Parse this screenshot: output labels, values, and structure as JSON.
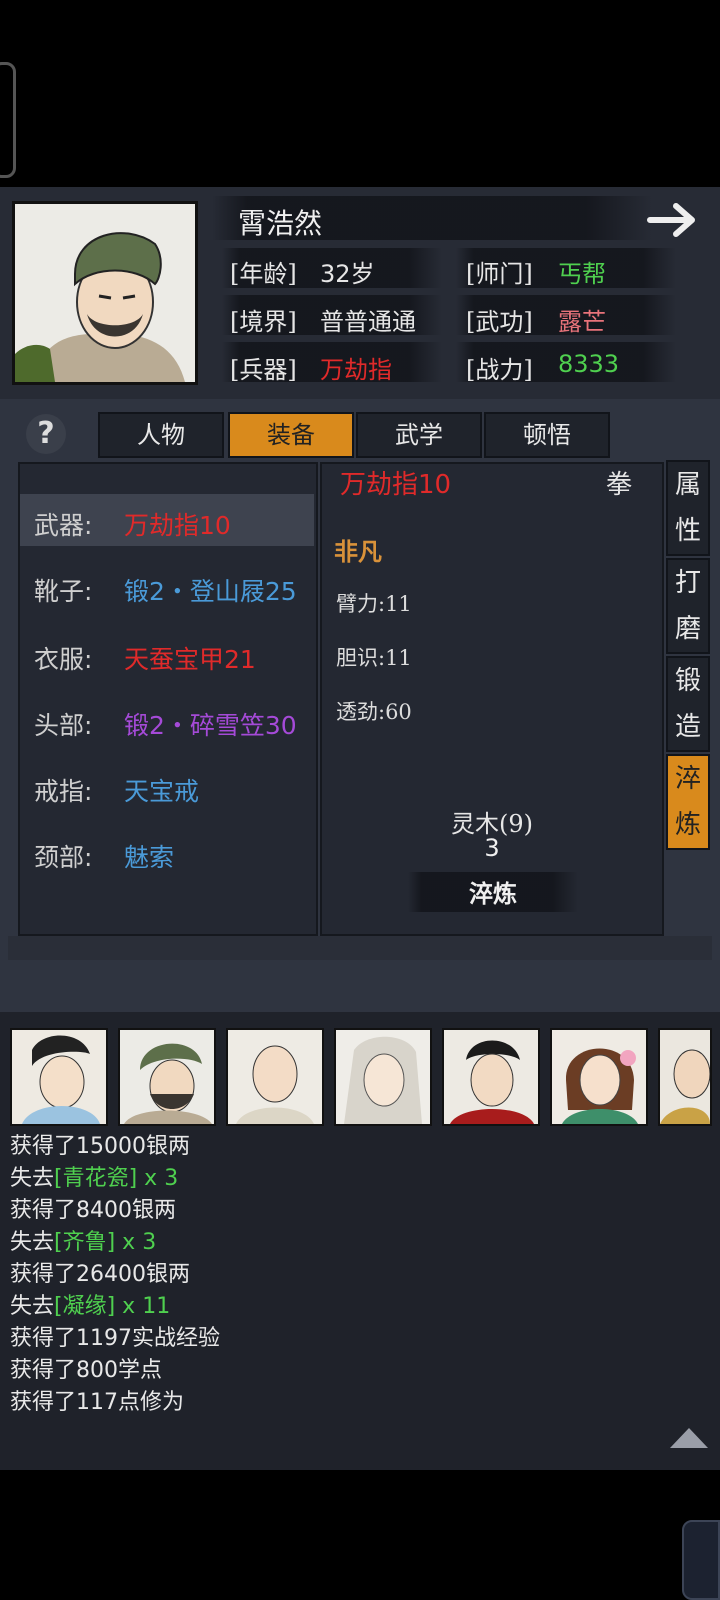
{
  "character": {
    "name": "霄浩然",
    "age_label": "[年龄]",
    "age": "32岁",
    "sect_label": "[师门]",
    "sect": "丐帮",
    "realm_label": "[境界]",
    "realm": "普普通通",
    "martial_label": "[武功]",
    "martial": "露芒",
    "weapon_label": "[兵器]",
    "weapon": "万劫指",
    "power_label": "[战力]",
    "power": "8333"
  },
  "help_icon": "?",
  "tabs": [
    "人物",
    "装备",
    "武学",
    "顿悟"
  ],
  "active_tab": "装备",
  "equipment": [
    {
      "slot": "武器:",
      "item": "万劫指10",
      "color": "#e02a2a"
    },
    {
      "slot": "靴子:",
      "item": "锻2・登山屐25",
      "color": "#4a9ad8"
    },
    {
      "slot": "衣服:",
      "item": "天蚕宝甲21",
      "color": "#e02a2a"
    },
    {
      "slot": "头部:",
      "item": "锻2・碎雪笠30",
      "color": "#a54ad8"
    },
    {
      "slot": "戒指:",
      "item": "天宝戒",
      "color": "#4a9ad8"
    },
    {
      "slot": "颈部:",
      "item": "魅索",
      "color": "#4a9ad8"
    }
  ],
  "detail": {
    "item_name": "万劫指10",
    "item_type": "拳",
    "rarity": "非凡",
    "stats": [
      "臂力:11",
      "胆识:11",
      "透劲:60"
    ],
    "material": "灵木(9)",
    "material_count": "3",
    "action_button": "淬炼"
  },
  "side_tabs": [
    {
      "c1": "属",
      "c2": "性"
    },
    {
      "c1": "打",
      "c2": "磨"
    },
    {
      "c1": "锻",
      "c2": "造"
    },
    {
      "c1": "淬",
      "c2": "炼"
    }
  ],
  "log": [
    {
      "prefix": "获得了15000银两",
      "item": "",
      "suffix": ""
    },
    {
      "prefix": "失去",
      "item": "[青花瓷]",
      "suffix": " x 3"
    },
    {
      "prefix": "获得了8400银两",
      "item": "",
      "suffix": ""
    },
    {
      "prefix": "失去",
      "item": "[齐鲁]",
      "suffix": " x 3"
    },
    {
      "prefix": "获得了26400银两",
      "item": "",
      "suffix": ""
    },
    {
      "prefix": "失去",
      "item": "[凝缘]",
      "suffix": " x 11"
    },
    {
      "prefix": "获得了1197实战经验",
      "item": "",
      "suffix": ""
    },
    {
      "prefix": "获得了800学点",
      "item": "",
      "suffix": ""
    },
    {
      "prefix": "获得了117点修为",
      "item": "",
      "suffix": ""
    }
  ],
  "colors": {
    "accent": "#d98a1c",
    "green": "#4fd04f",
    "red": "#e02a2a",
    "blue": "#4a9ad8",
    "purple": "#a54ad8",
    "orange": "#d9923a"
  }
}
